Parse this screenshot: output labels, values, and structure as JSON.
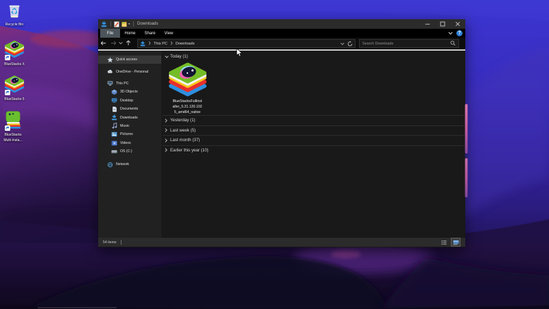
{
  "desktop": {
    "icons": [
      {
        "label": "Recycle Bin",
        "kind": "recycle-bin"
      },
      {
        "label": "BlueStacks X",
        "kind": "bluestacks-x"
      },
      {
        "label": "BlueStacks 5",
        "kind": "bluestacks-5"
      },
      {
        "label": "BlueStacks",
        "label2": "Multi-Insta...",
        "kind": "bluestacks-multi-instance"
      }
    ]
  },
  "window": {
    "title": "Downloads",
    "titlebar": {
      "caret": "▾",
      "minimize": "–",
      "maximize": "▢",
      "close": "✕"
    },
    "menu_tabs": [
      {
        "label": "File"
      },
      {
        "label": "Home"
      },
      {
        "label": "Share"
      },
      {
        "label": "View"
      }
    ],
    "help_label": "?",
    "address": {
      "back": "←",
      "forward": "→",
      "up": "↑",
      "crumbs": [
        "This PC",
        "Downloads"
      ],
      "refresh": "⟳",
      "search_placeholder": "Search Downloads"
    },
    "sidebar": [
      {
        "label": "Quick access"
      },
      {
        "label": "OneDrive - Personal"
      },
      {
        "label": "This PC"
      },
      {
        "label": "3D Objects"
      },
      {
        "label": "Desktop"
      },
      {
        "label": "Documents"
      },
      {
        "label": "Downloads"
      },
      {
        "label": "Music"
      },
      {
        "label": "Pictures"
      },
      {
        "label": "Videos"
      },
      {
        "label": "OS (C:)"
      },
      {
        "label": "Network"
      }
    ],
    "groups": [
      {
        "label": "Today (1)",
        "expanded": true
      },
      {
        "label": "Yesterday (1)",
        "expanded": false
      },
      {
        "label": "Last week (5)",
        "expanded": false
      },
      {
        "label": "Last month (37)",
        "expanded": false
      },
      {
        "label": "Earlier this year (10)",
        "expanded": false
      }
    ],
    "file_item": {
      "name_line1": "BlueStacksFullInst",
      "name_line2": "aller_5.21.120.102",
      "name_line3": "5_amd64_native"
    },
    "statusbar": {
      "items_count": "54 items"
    }
  },
  "colors": {
    "accent_blue": "#2f8fe0",
    "wallpaper_top": "#3b35d0",
    "wallpaper_purple": "#5e2b8a",
    "titlebar": "#2b2b2b",
    "pane": "#191919"
  }
}
